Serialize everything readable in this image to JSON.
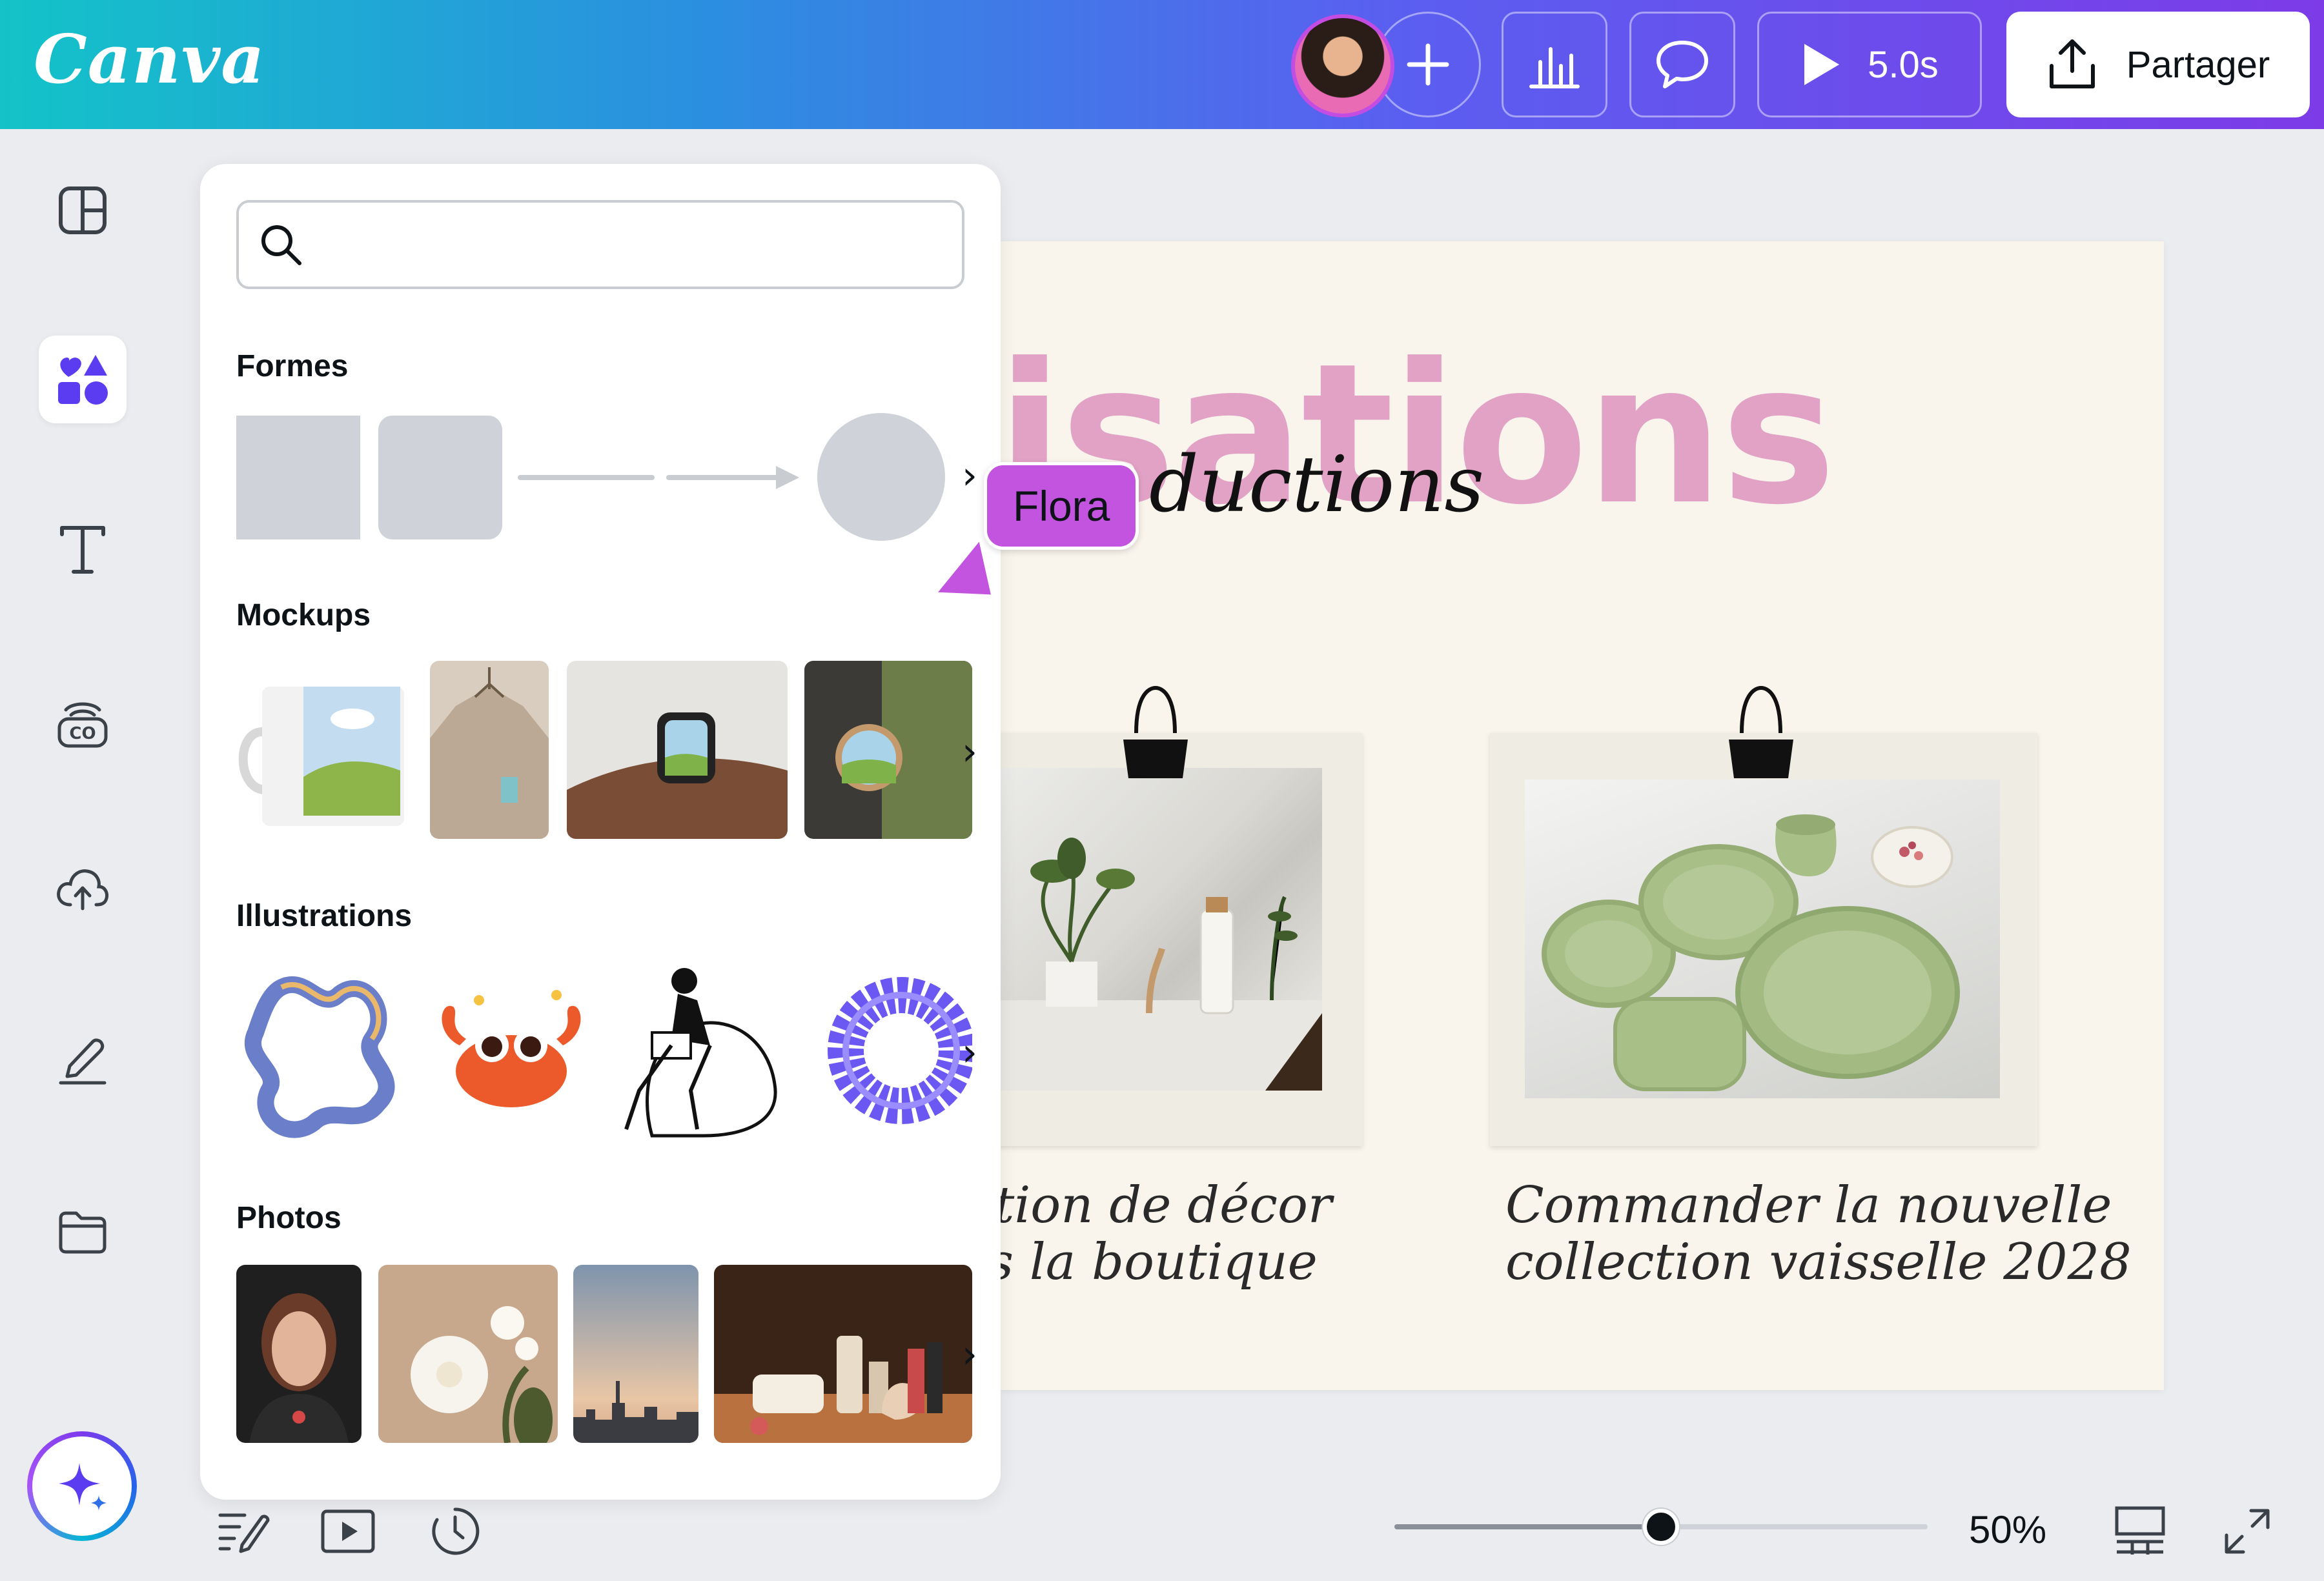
{
  "app": {
    "logo": "Canva"
  },
  "topbar": {
    "duration_label": "5.0s",
    "share_label": "Partager",
    "icons": {
      "add": "plus-icon",
      "stats": "bar-chart-icon",
      "comment": "comment-icon",
      "play": "play-icon",
      "share": "upload-icon"
    }
  },
  "sidebar": {
    "items": [
      {
        "icon": "layout-icon"
      },
      {
        "icon": "elements-icon",
        "active": true
      },
      {
        "icon": "text-icon"
      },
      {
        "icon": "brand-icon"
      },
      {
        "icon": "cloud-upload-icon"
      },
      {
        "icon": "draw-icon"
      },
      {
        "icon": "folder-icon"
      }
    ],
    "magic_icon": "sparkle-icon"
  },
  "panel": {
    "search": {
      "value": "",
      "placeholder": ""
    },
    "sections": {
      "shapes": "Formes",
      "mockups": "Mockups",
      "illustrations": "Illustrations",
      "photos": "Photos"
    }
  },
  "canvas": {
    "title_fragment": "isations",
    "subtitle_fragment": "ductions",
    "caption_left_line1": "tion de décor",
    "caption_left_line2": "s la boutique",
    "caption_right_line1": "Commander la nouvelle",
    "caption_right_line2": "collection vaisselle 2028"
  },
  "collaborator": {
    "name": "Flora",
    "color": "#c254e0"
  },
  "bottombar": {
    "zoom_label": "50%",
    "zoom_percent": 50,
    "icons": [
      "notes-icon",
      "present-icon",
      "timer-icon",
      "grid-view-icon",
      "fullscreen-icon"
    ]
  },
  "colors": {
    "gradient_start": "#13c3c8",
    "gradient_end": "#7d3be8",
    "accent": "#8b3dff",
    "title_pink": "#e2a2c6"
  }
}
